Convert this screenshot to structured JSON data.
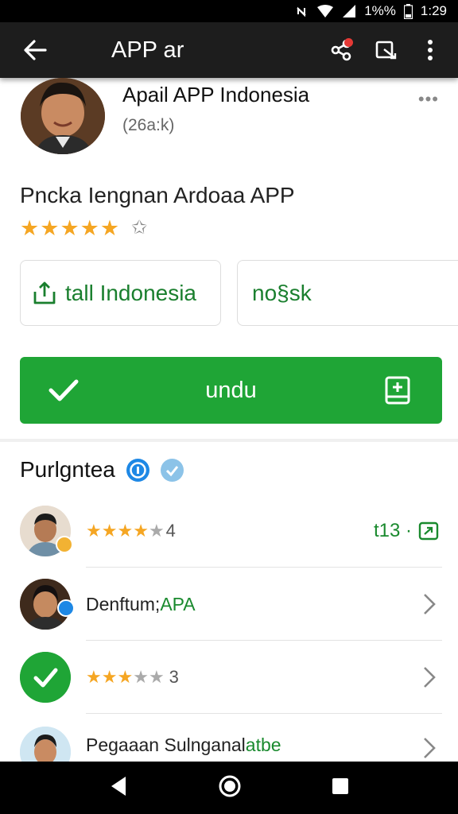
{
  "status_bar": {
    "battery_text": "1%%",
    "time": "1:29"
  },
  "app_bar": {
    "title": "APP ar"
  },
  "profile": {
    "name": "Apail APP Indonesia",
    "subtitle": "(26a:k)",
    "more": "•••"
  },
  "app": {
    "name": "Pncka Iengnan Ardoaa APP",
    "rating_full_stars": 5,
    "star_char": "★",
    "star_outline_char": "✩"
  },
  "cards": {
    "install_label": "tall Indonesia",
    "second_label": "no§sk"
  },
  "download": {
    "label": "undu"
  },
  "section": {
    "title": "Purlgntea"
  },
  "list": [
    {
      "rating_value": "4",
      "right_text": "t13 ·"
    },
    {
      "text_main": "Denftum; ",
      "text_green": "APA"
    },
    {
      "rating_value": "3"
    },
    {
      "text_main": "Pegaaan Sulnganal ",
      "text_green": "atbe"
    }
  ],
  "colors": {
    "accent_green": "#1fa536",
    "star_gold": "#f5a623",
    "app_bar": "#1d1d1d",
    "notification_red": "#e53935",
    "badge_blue": "#1e88e5"
  }
}
